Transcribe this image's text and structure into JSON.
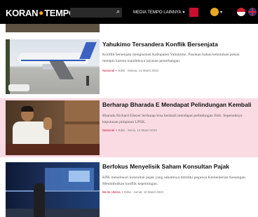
{
  "header": {
    "logo": {
      "left": "KORAN",
      "dot": "●",
      "right": "TEMPO"
    },
    "search": {
      "placeholder": "",
      "icon": "search-icon"
    },
    "nav_link": "MEDIA TEMPO LAINNYA",
    "nav_chevron": "▾",
    "coin_chevron": "▾"
  },
  "articles": [
    {
      "title": "Yahukimo Tersandera Konflik Bersenjata",
      "summary": "Konflik bersenjata mengisolasi Kabupaten Yahukimo. Pasokan bahan kebutuhan pokok menipis karena mandeknya layanan penerbangan.",
      "category": "Nasional",
      "edition": "Edisi : Selasa, 14 Maret 2023"
    },
    {
      "title": "Berharap Bharada E Mendapat Pelindungan Kembali",
      "summary": "Bharada Richard Eliezer berharap bisa kembali mendapat pelindungan fisik. Sepenuhnya keputusan pimpinan LPSK.",
      "category": "Nasional",
      "edition": "Edisi : Senin, 13 Maret 2023"
    },
    {
      "title": "Berfokus Menyelisik Saham Konsultan Pajak",
      "summary": "KPK menelusuri konsultan pajak yang sahamnya dimiliki pegawai Kementerian Keuangan. Menimbulkan konflik kepentingan.",
      "category": "Berita Utama",
      "edition": "Edisi : Jumat, 10 Maret 2023"
    }
  ],
  "colors": {
    "topbar": "#000000",
    "accent": "#c8102e",
    "highlight": "#fadbe4"
  }
}
